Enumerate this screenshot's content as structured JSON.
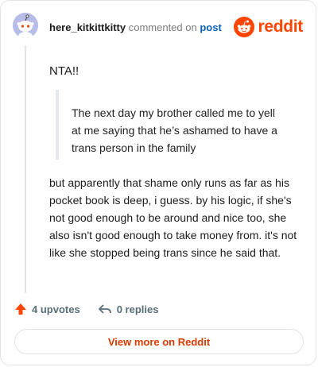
{
  "comment": {
    "username": "here_kitkittkitty",
    "commented_on_text": "commented on",
    "post_link": "post",
    "first_line": "NTA!!",
    "quote": "The next day my brother called me to yell at me saying that he’s ashamed to have a trans person in the family",
    "body": "but apparently that shame only runs as far as his pocket book is deep, i guess. by his logic, if she's not good enough to be around and nice too, she also isn't good enough to take money from. it's not like she stopped being trans since he said that."
  },
  "brand": {
    "name": "reddit",
    "icon": "reddit-logo-icon",
    "color": "#ff4500"
  },
  "actions": {
    "upvotes": "4 upvotes",
    "upvote_icon": "upvote-arrow-icon",
    "replies": "0 replies",
    "reply_icon": "reply-arrow-icon"
  },
  "view_more": "View more on Reddit",
  "colors": {
    "accent": "#d93a00",
    "link": "#0b5fb8",
    "avatar": "#b7bde6"
  }
}
